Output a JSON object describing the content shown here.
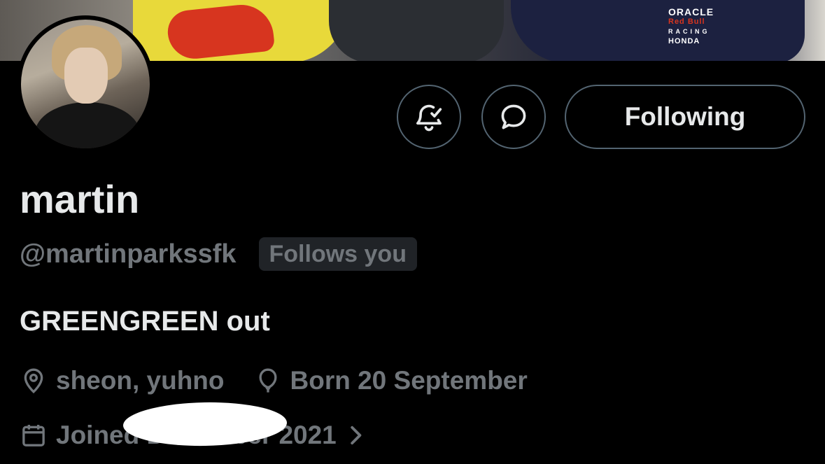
{
  "header": {
    "banner_logo_line1": "ORACLE",
    "banner_logo_line2": "Red Bull",
    "banner_logo_line3": "RACING",
    "banner_logo_line4": "HONDA"
  },
  "actions": {
    "notify_icon": "bell-check-icon",
    "message_icon": "chat-bubble-icon",
    "follow_label": "Following"
  },
  "profile": {
    "display_name": "martin",
    "handle": "@martinparkssfk",
    "follows_you_badge": "Follows you",
    "bio": "GREENGREEN out",
    "location": "sheon, yuhno",
    "birthday": "Born 20 September",
    "joined_prefix": "Joined December",
    "joined_year": "2021"
  },
  "colors": {
    "background": "#000000",
    "primary_text": "#e7e9ea",
    "secondary_text": "#71767b",
    "border": "#536471",
    "badge_bg": "#202327"
  }
}
